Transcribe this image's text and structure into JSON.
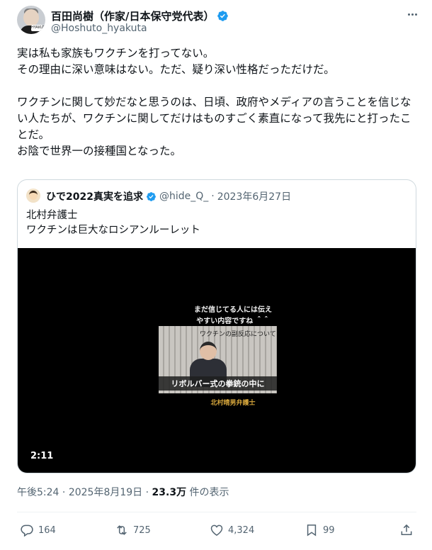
{
  "author": {
    "display_name": "百田尚樹（作家/日本保守党代表）",
    "handle": "@Hoshuto_hyakuta",
    "avatar_tag": "HYAKUTA"
  },
  "post": {
    "paragraphs": [
      "実は私も家族もワクチンを打ってない。\nその理由に深い意味はない。ただ、疑り深い性格だっただけだ。",
      "ワクチンに関して妙だなと思うのは、日頃、政府やメディアの言うことを信じない人たちが、ワクチンに関してだけはものすごく素直になって我先にと打ったことだ。\nお陰で世界一の接種国となった。"
    ]
  },
  "quoted": {
    "display_name": "ひで2022真実を追求",
    "handle": "@hide_Q_",
    "separator": "·",
    "date": "2023年6月27日",
    "lines": [
      "北村弁護士",
      "ワクチンは巨大なロシアンルーレット"
    ],
    "video": {
      "duration": "2:11",
      "top_text_1": "まだ信じてる人には伝え",
      "top_text_2": "やすい内容ですね ＾＾",
      "frame_title": "ワクチンの副反応について",
      "subtitle": "リボルバー式の拳銃の中に",
      "caption": "北村晴男弁護士"
    }
  },
  "meta": {
    "time": "午後5:24",
    "separator": "·",
    "date": "2025年8月19日",
    "views": "23.3万",
    "views_label": "件の表示"
  },
  "actions": {
    "replies": "164",
    "reposts": "725",
    "likes": "4,324",
    "bookmarks": "99"
  },
  "colors": {
    "verified": "#1d9bf0",
    "secondary_text": "#536471",
    "border": "#cfd9de"
  }
}
